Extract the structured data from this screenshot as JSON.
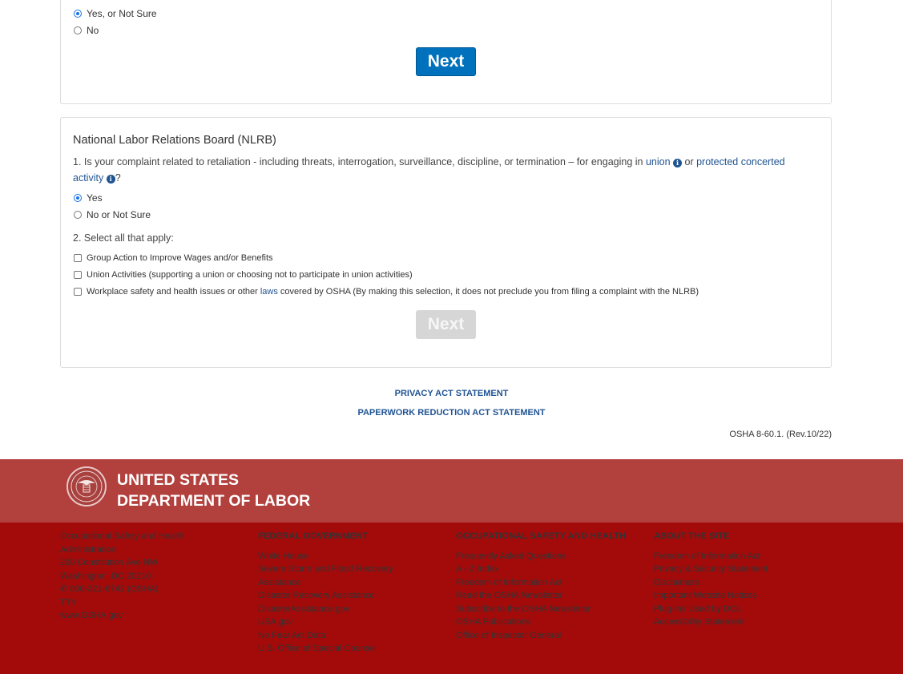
{
  "panel1": {
    "options": [
      {
        "label": "Yes, or Not Sure",
        "checked": true
      },
      {
        "label": "No",
        "checked": false
      }
    ],
    "next_label": "Next"
  },
  "nlrb": {
    "title": "National Labor Relations Board (NLRB)",
    "q1_prefix": "1. Is your complaint related to retaliation - including threats, interrogation, surveillance, discipline, or termination – for engaging in ",
    "q1_link_union": "union",
    "q1_or": " or ",
    "q1_link_protected": "protected concerted activity",
    "q1_suffix": "?",
    "q1_options": [
      {
        "label": "Yes",
        "checked": true
      },
      {
        "label": "No or Not Sure",
        "checked": false
      }
    ],
    "q2_label": "2. Select all that apply:",
    "q2_options": [
      {
        "label": "Group Action to Improve Wages and/or Benefits"
      },
      {
        "label": "Union Activities (supporting a union or choosing not to participate in union activities)"
      },
      {
        "label_prefix": "Workplace safety and health issues or other ",
        "label_link": "laws",
        "label_suffix": " covered by OSHA (By making this selection, it does not preclude you from filing a complaint with the NLRB)"
      }
    ],
    "next_label": "Next"
  },
  "links": {
    "privacy": "PRIVACY ACT STATEMENT",
    "paperwork": "PAPERWORK REDUCTION ACT STATEMENT"
  },
  "form_number": "OSHA 8-60.1. (Rev.10/22)",
  "footer": {
    "brand_line1": "UNITED STATES",
    "brand_line2": "DEPARTMENT OF LABOR",
    "address": {
      "line1": "Occupational Safety and Health",
      "line2": "Administration",
      "line3": "200 Constitution Ave NW",
      "line4": "Washington, DC 20210",
      "phone": "800-321-6742 (OSHA)",
      "tty": "TTY",
      "site": "www.OSHA.gov"
    },
    "federal": {
      "heading": "FEDERAL GOVERNMENT",
      "items": [
        "White House",
        "Severe Storm and Flood Recovery",
        "Assistance",
        "Disaster Recovery Assistance",
        "DisasterAssistance.gov",
        "USA.gov",
        "No Fear Act Data",
        "U.S. Office of Special Counsel"
      ]
    },
    "osha": {
      "heading": "OCCUPATIONAL SAFETY AND HEALTH",
      "items": [
        "Frequently Asked Questions",
        "A - Z Index",
        "Freedom of Information Act",
        "Read the OSHA Newsletter",
        "Subscribe to the OSHA Newsletter",
        "OSHA Publications",
        "Office of Inspector General"
      ]
    },
    "about": {
      "heading": "ABOUT THE SITE",
      "items": [
        "Freedom of Information Act",
        "Privacy & Security Statement",
        "Disclaimers",
        "Important Website Notices",
        "Plug-Ins Used by DOL",
        "Accessibility Statement"
      ]
    }
  },
  "colors": {
    "primary_button": "#0071bc",
    "link": "#205493",
    "footer_top": "#b2403d",
    "footer_bottom": "#a30b0b"
  }
}
